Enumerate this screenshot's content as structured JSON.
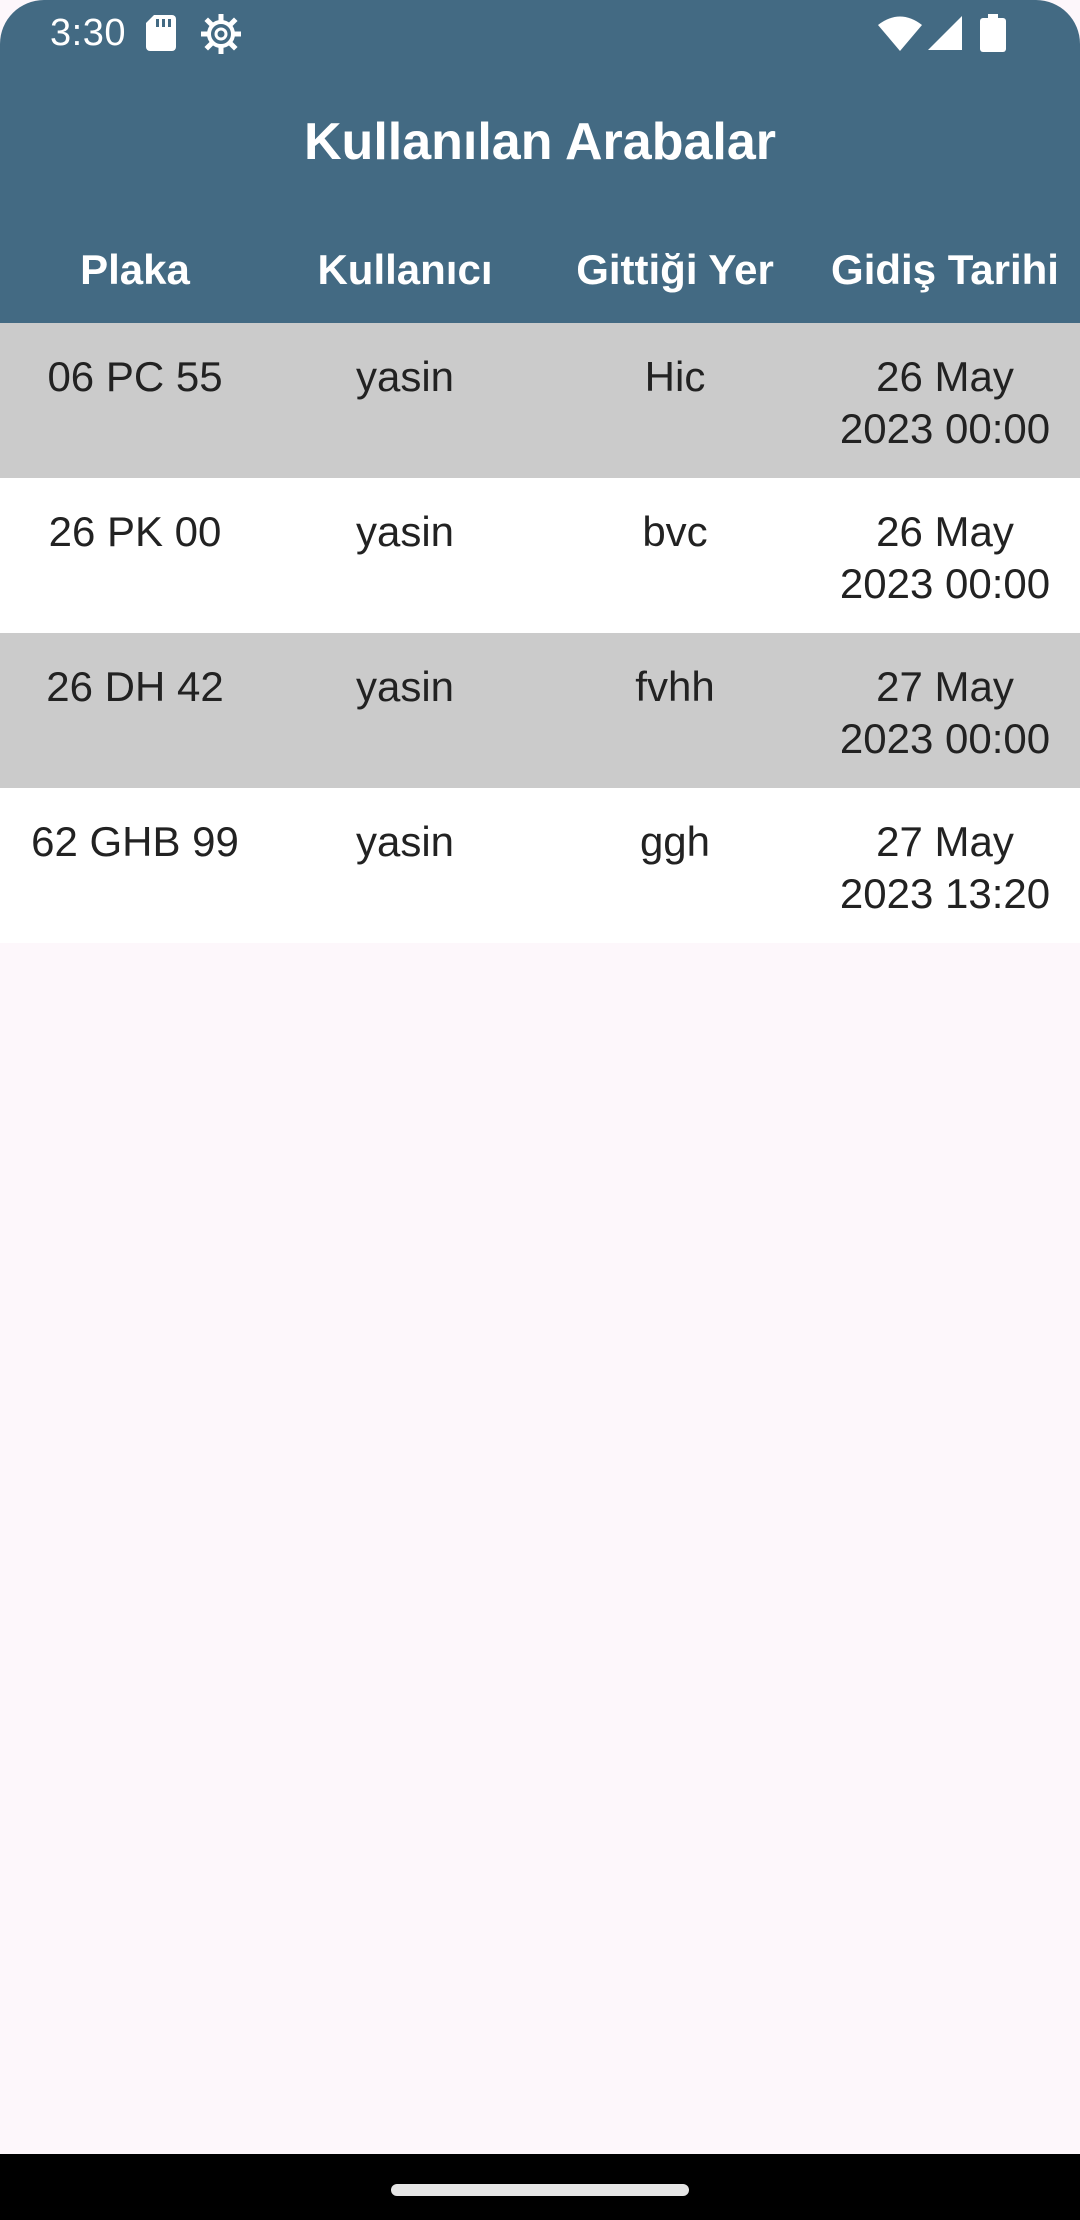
{
  "status_bar": {
    "time": "3:30",
    "icons": [
      "sd-card-icon",
      "gear-icon",
      "wifi-icon",
      "signal-icon",
      "battery-icon"
    ]
  },
  "header": {
    "title": "Kullanılan Arabalar",
    "bg_color": "#436a83"
  },
  "table": {
    "columns": [
      "Plaka",
      "Kullanıcı",
      "Gittiği Yer",
      "Gidiş Tarihi"
    ],
    "rows": [
      {
        "plate": "06 PC 55",
        "user": "yasin",
        "destination": "Hic",
        "date_line1": "26 May",
        "date_line2": "2023 00:00"
      },
      {
        "plate": "26 PK 00",
        "user": "yasin",
        "destination": "bvc",
        "date_line1": "26 May",
        "date_line2": "2023 00:00"
      },
      {
        "plate": "26 DH 42",
        "user": "yasin",
        "destination": "fvhh",
        "date_line1": "27 May",
        "date_line2": "2023 00:00"
      },
      {
        "plate": "62 GHB 99",
        "user": "yasin",
        "destination": "ggh",
        "date_line1": "27 May",
        "date_line2": "2023 13:20"
      }
    ],
    "alt_row_color": "#cbcbcb"
  }
}
